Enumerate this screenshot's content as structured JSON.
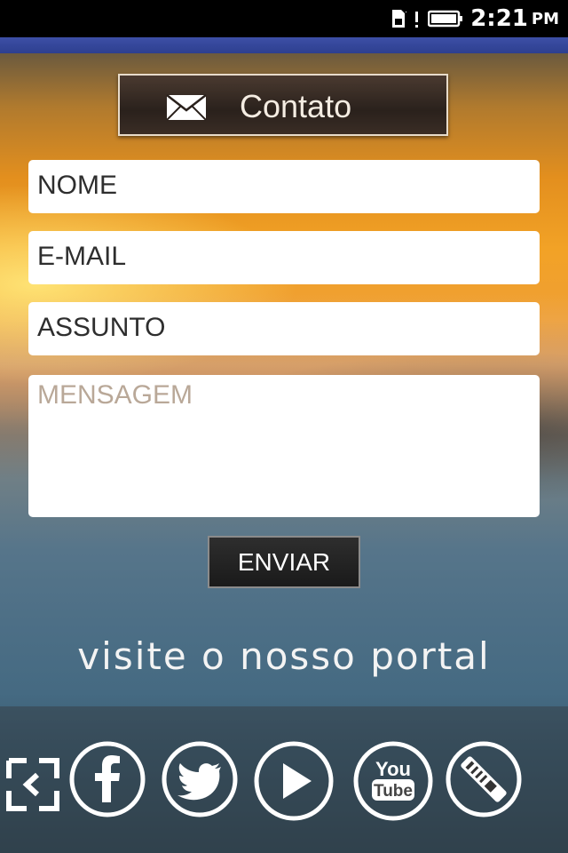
{
  "status_bar": {
    "time": "2:21",
    "ampm": "PM",
    "icons": [
      "sim-icon",
      "battery-icon"
    ]
  },
  "header": {
    "title": "Contato",
    "icon": "envelope-icon"
  },
  "form": {
    "name_value": "NOME",
    "email_value": "E-MAIL",
    "subject_value": "ASSUNTO",
    "message_placeholder": "MENSAGEM",
    "send_label": "ENVIAR"
  },
  "footer": {
    "portal_text": "visite o nosso portal",
    "social_icons": [
      "back-icon",
      "facebook-icon",
      "twitter-icon",
      "play-icon",
      "youtube-icon",
      "remote-icon"
    ],
    "youtube_top": "You",
    "youtube_bottom": "Tube"
  },
  "colors": {
    "accent": "#3d4fa6",
    "button_dark": "#2a211c",
    "placeholder": "#b9a898"
  }
}
